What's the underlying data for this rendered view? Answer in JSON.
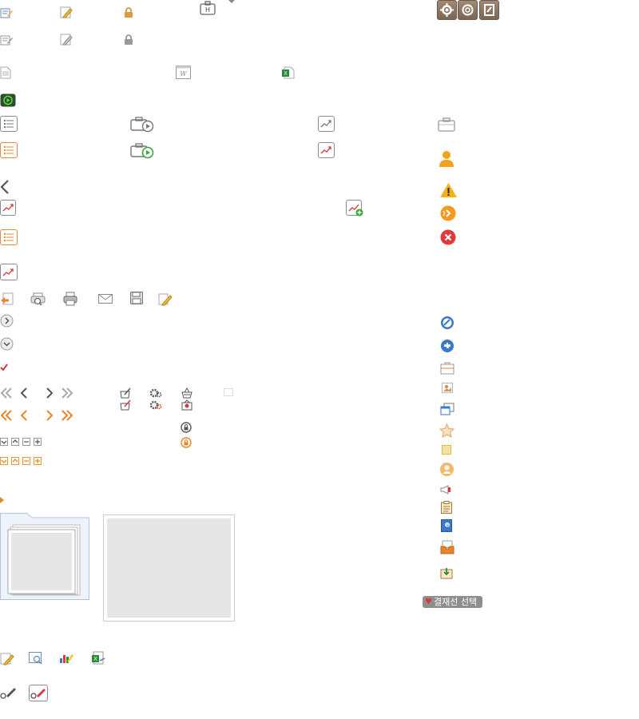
{
  "approval_button": {
    "label": "결재선 선택",
    "marker_icon": "heart-icon"
  },
  "colors": {
    "accent_orange": "#e8842a",
    "gray_icon": "#888888",
    "brown_button": "#8a7460",
    "status_red": "#e03a3a",
    "status_warning": "#f2b21a"
  }
}
